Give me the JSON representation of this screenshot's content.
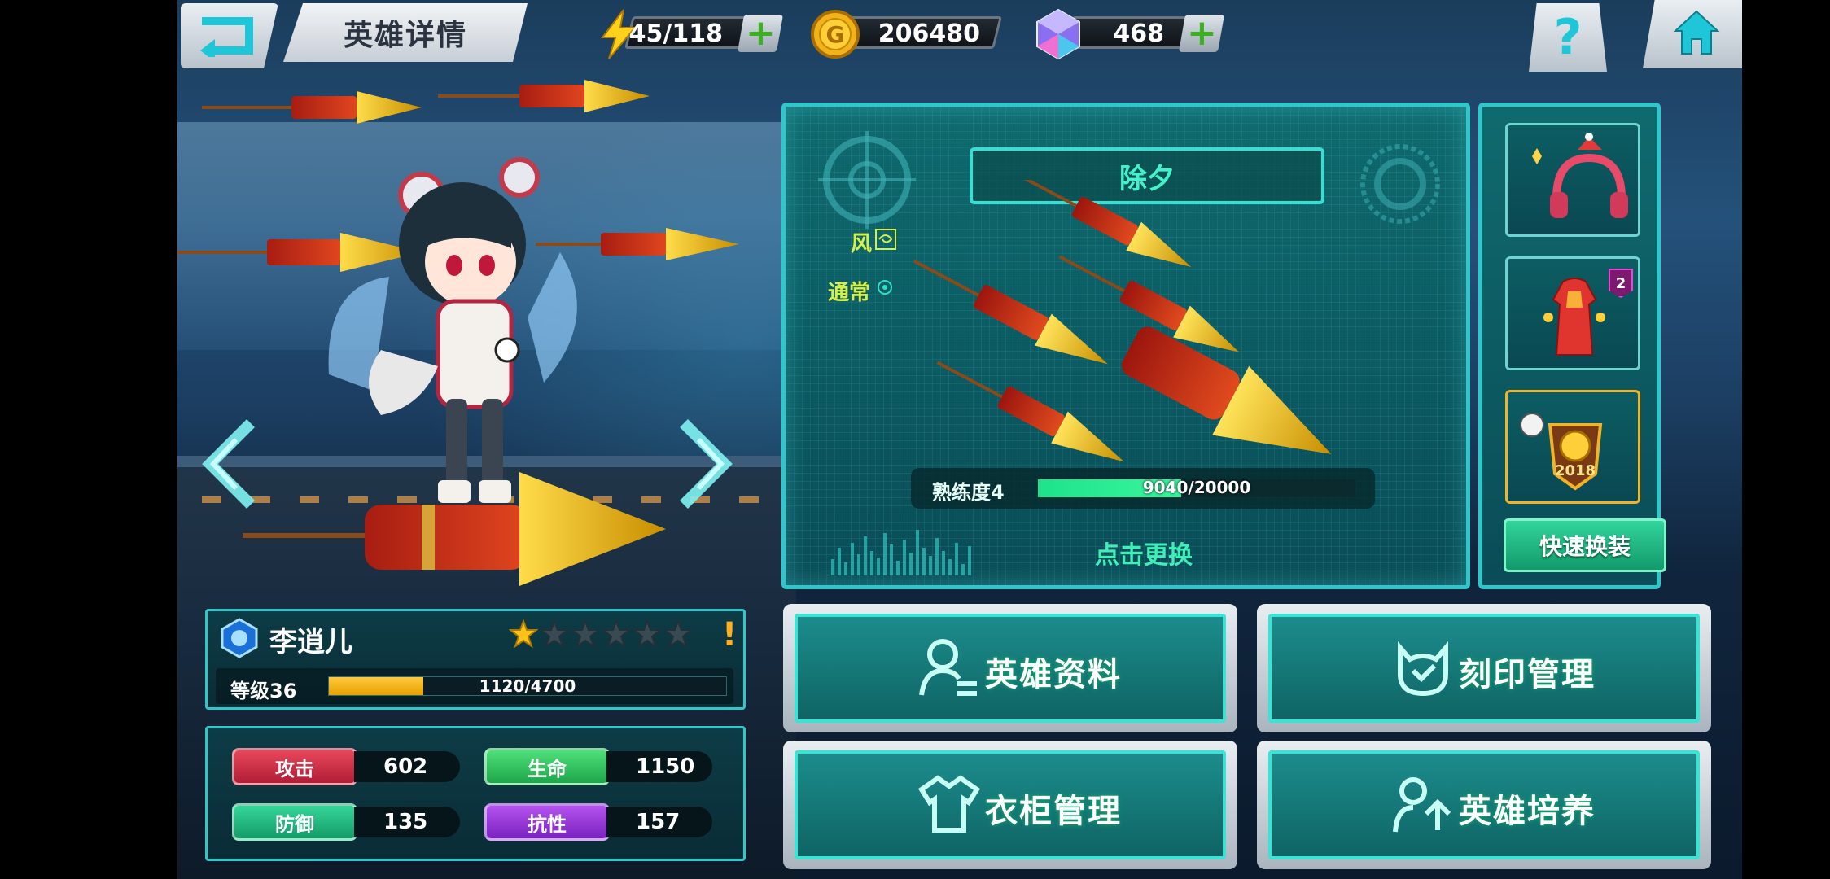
{
  "header": {
    "title": "英雄详情",
    "energy": "45/118",
    "gold": "206480",
    "gems": "468",
    "help_label": "?"
  },
  "weapon": {
    "name": "除夕",
    "element": "风",
    "attack_type": "通常",
    "proficiency_label": "熟练度4",
    "proficiency_value": "9040/20000",
    "proficiency_ratio": 0.452,
    "change_label": "点击更换"
  },
  "equipment": {
    "slots": [
      {
        "name": "headphones",
        "badge": ""
      },
      {
        "name": "dress",
        "badge": "2"
      },
      {
        "name": "trophy-badge",
        "emblem_text": "2018"
      }
    ],
    "quick_change_label": "快速换装"
  },
  "hero": {
    "name": "李逍儿",
    "stars_filled": 1,
    "stars_total": 6,
    "warning": "!",
    "level_label": "等级36",
    "exp_value": "1120/4700",
    "exp_ratio": 0.238,
    "stats": [
      {
        "label": "攻击",
        "value": "602",
        "color": "#e8475b"
      },
      {
        "label": "生命",
        "value": "1150",
        "color": "#4fe07a"
      },
      {
        "label": "防御",
        "value": "135",
        "color": "#36d69a"
      },
      {
        "label": "抗性",
        "value": "157",
        "color": "#b552ef"
      }
    ]
  },
  "menu": {
    "hero_info": "英雄资料",
    "imprint": "刻印管理",
    "wardrobe": "衣柜管理",
    "training": "英雄培养"
  },
  "colors": {
    "accent": "#2fc7c9",
    "panel": "#0f6a6e",
    "highlight": "#43f2c8"
  }
}
